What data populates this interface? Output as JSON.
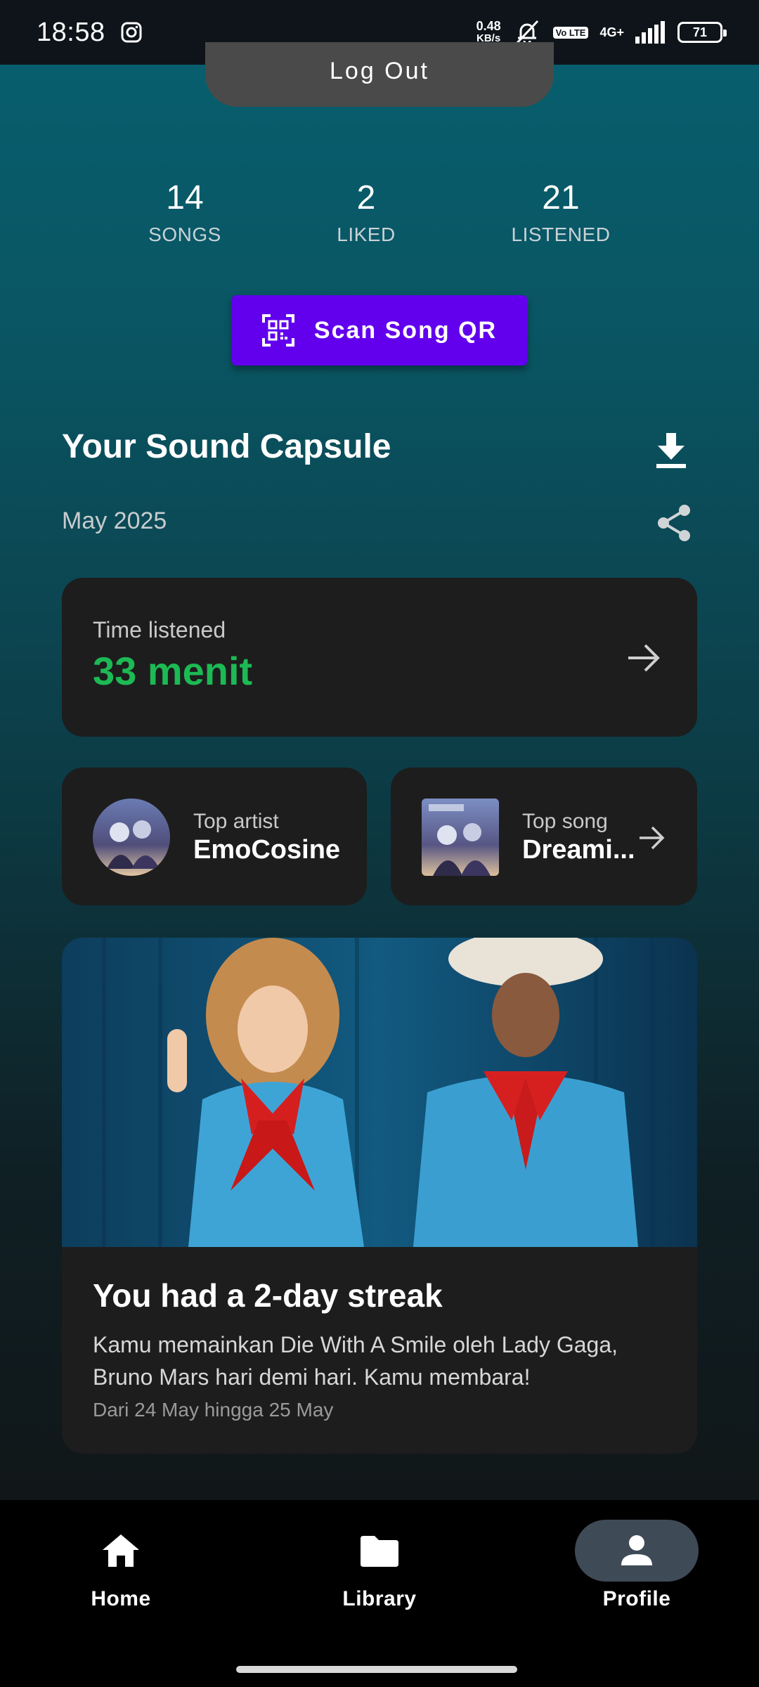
{
  "status_bar": {
    "time": "18:58",
    "net_speed_value": "0.48",
    "net_speed_unit": "KB/s",
    "volte": "Vo LTE",
    "network": "4G+",
    "battery": "71"
  },
  "header": {
    "logout_label": "Log Out"
  },
  "stats": [
    {
      "value": "14",
      "label": "SONGS"
    },
    {
      "value": "2",
      "label": "LIKED"
    },
    {
      "value": "21",
      "label": "LISTENED"
    }
  ],
  "scan_button": {
    "label": "Scan Song QR"
  },
  "capsule": {
    "title": "Your Sound Capsule",
    "date": "May 2025",
    "time_listened": {
      "label": "Time listened",
      "value": "33 menit"
    },
    "top_artist": {
      "label": "Top artist",
      "value": "EmoCosine"
    },
    "top_song": {
      "label": "Top song",
      "value": "Dreami..."
    },
    "streak": {
      "title": "You had a 2-day streak",
      "description": "Kamu memainkan Die With A Smile oleh Lady Gaga, Bruno Mars hari demi hari. Kamu membara!",
      "range": "Dari 24 May hingga 25 May"
    }
  },
  "bottom_nav": [
    {
      "label": "Home",
      "icon": "home-icon",
      "active": false
    },
    {
      "label": "Library",
      "icon": "folder-icon",
      "active": false
    },
    {
      "label": "Profile",
      "icon": "person-icon",
      "active": true
    }
  ],
  "colors": {
    "accent_purple": "#6200ee",
    "green": "#1db954",
    "card": "#1d1d1d"
  }
}
